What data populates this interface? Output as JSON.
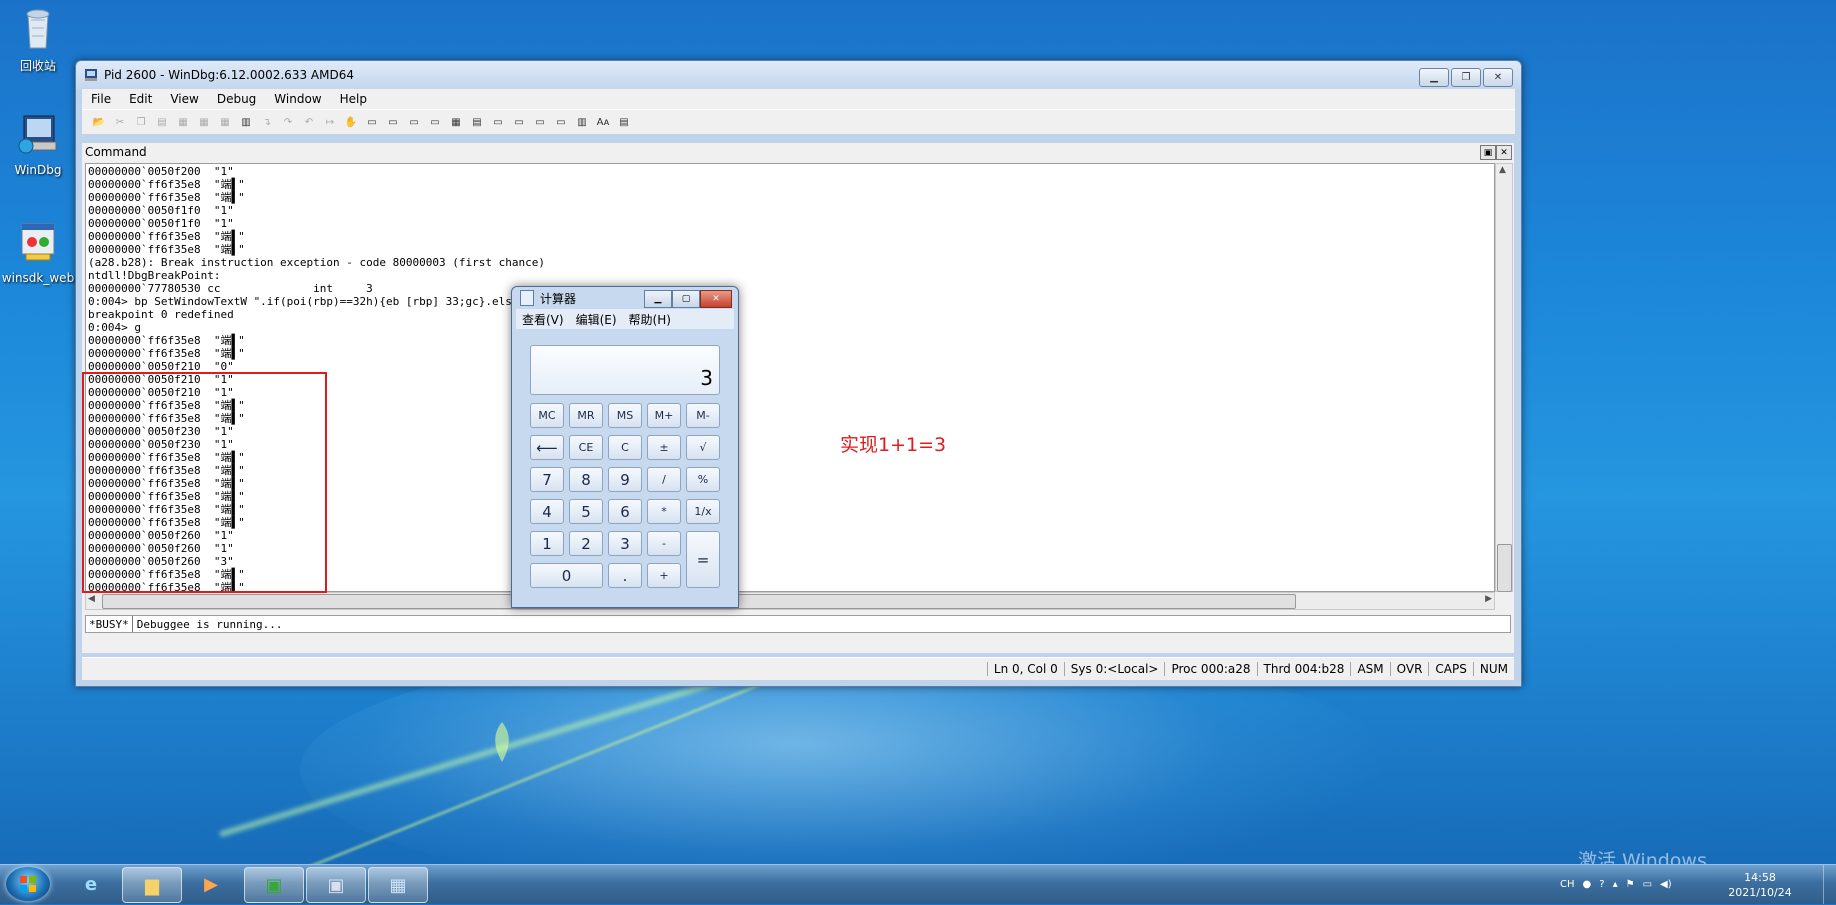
{
  "desktop": {
    "icons": [
      {
        "label": "回收站",
        "icon": "recycle-bin-icon"
      },
      {
        "label": "WinDbg",
        "icon": "windbg-icon"
      },
      {
        "label": "winsdk_web",
        "icon": "installer-icon"
      }
    ],
    "annotation": "实现1+1=3",
    "watermark": "激活 Windows"
  },
  "windbg": {
    "title": "Pid 2600 - WinDbg:6.12.0002.633 AMD64",
    "menu": [
      "File",
      "Edit",
      "View",
      "Debug",
      "Window",
      "Help"
    ],
    "command_title": "Command",
    "output_lines": [
      "00000000`0050f200  \"1\"",
      "00000000`ff6f35e8  \"端▌\"",
      "00000000`ff6f35e8  \"端▌\"",
      "00000000`0050f1f0  \"1\"",
      "00000000`0050f1f0  \"1\"",
      "00000000`ff6f35e8  \"端▌\"",
      "00000000`ff6f35e8  \"端▌\"",
      "(a28.b28): Break instruction exception - code 80000003 (first chance)",
      "ntdll!DbgBreakPoint:",
      "00000000`77780530 cc              int     3",
      "0:004> bp SetWindowTextW \".if(poi(rbp)==32h){eb [rbp] 33;gc}.else{du [rbp];gc}\"",
      "breakpoint 0 redefined",
      "0:004> g",
      "00000000`ff6f35e8  \"端▌\"",
      "00000000`ff6f35e8  \"端▌\"",
      "00000000`0050f210  \"0\"",
      "00000000`0050f210  \"1\"",
      "00000000`0050f210  \"1\"",
      "00000000`ff6f35e8  \"端▌\"",
      "00000000`ff6f35e8  \"端▌\"",
      "00000000`0050f230  \"1\"",
      "00000000`0050f230  \"1\"",
      "00000000`ff6f35e8  \"端▌\"",
      "00000000`ff6f35e8  \"端▌\"",
      "00000000`ff6f35e8  \"端▌\"",
      "00000000`ff6f35e8  \"端▌\"",
      "00000000`ff6f35e8  \"端▌\"",
      "00000000`ff6f35e8  \"端▌\"",
      "00000000`0050f260  \"1\"",
      "00000000`0050f260  \"1\"",
      "00000000`0050f260  \"3\"",
      "00000000`ff6f35e8  \"端▌\"",
      "00000000`ff6f35e8  \"端▌\""
    ],
    "cmd_prompt": "*BUSY*",
    "cmd_status": "Debuggee is running...",
    "status": {
      "position": "Ln 0, Col 0",
      "sys": "Sys 0:<Local>",
      "proc": "Proc 000:a28",
      "thrd": "Thrd 004:b28",
      "asm": "ASM",
      "ovr": "OVR",
      "caps": "CAPS",
      "num": "NUM"
    }
  },
  "calculator": {
    "title": "计算器",
    "menu": [
      "查看(V)",
      "编辑(E)",
      "帮助(H)"
    ],
    "display": "3",
    "keys": {
      "mc": "MC",
      "mr": "MR",
      "ms": "MS",
      "mplus": "M+",
      "mminus": "M-",
      "back": "⟵",
      "ce": "CE",
      "c": "C",
      "plusminus": "±",
      "sqrt": "√",
      "k7": "7",
      "k8": "8",
      "k9": "9",
      "div": "/",
      "pct": "%",
      "k4": "4",
      "k5": "5",
      "k6": "6",
      "mul": "*",
      "recip": "1/x",
      "k1": "1",
      "k2": "2",
      "k3": "3",
      "sub": "-",
      "eq": "=",
      "k0": "0",
      "dot": ".",
      "add": "+"
    }
  },
  "taskbar": {
    "ime": "CH",
    "time": "14:58",
    "date": "2021/10/24"
  }
}
